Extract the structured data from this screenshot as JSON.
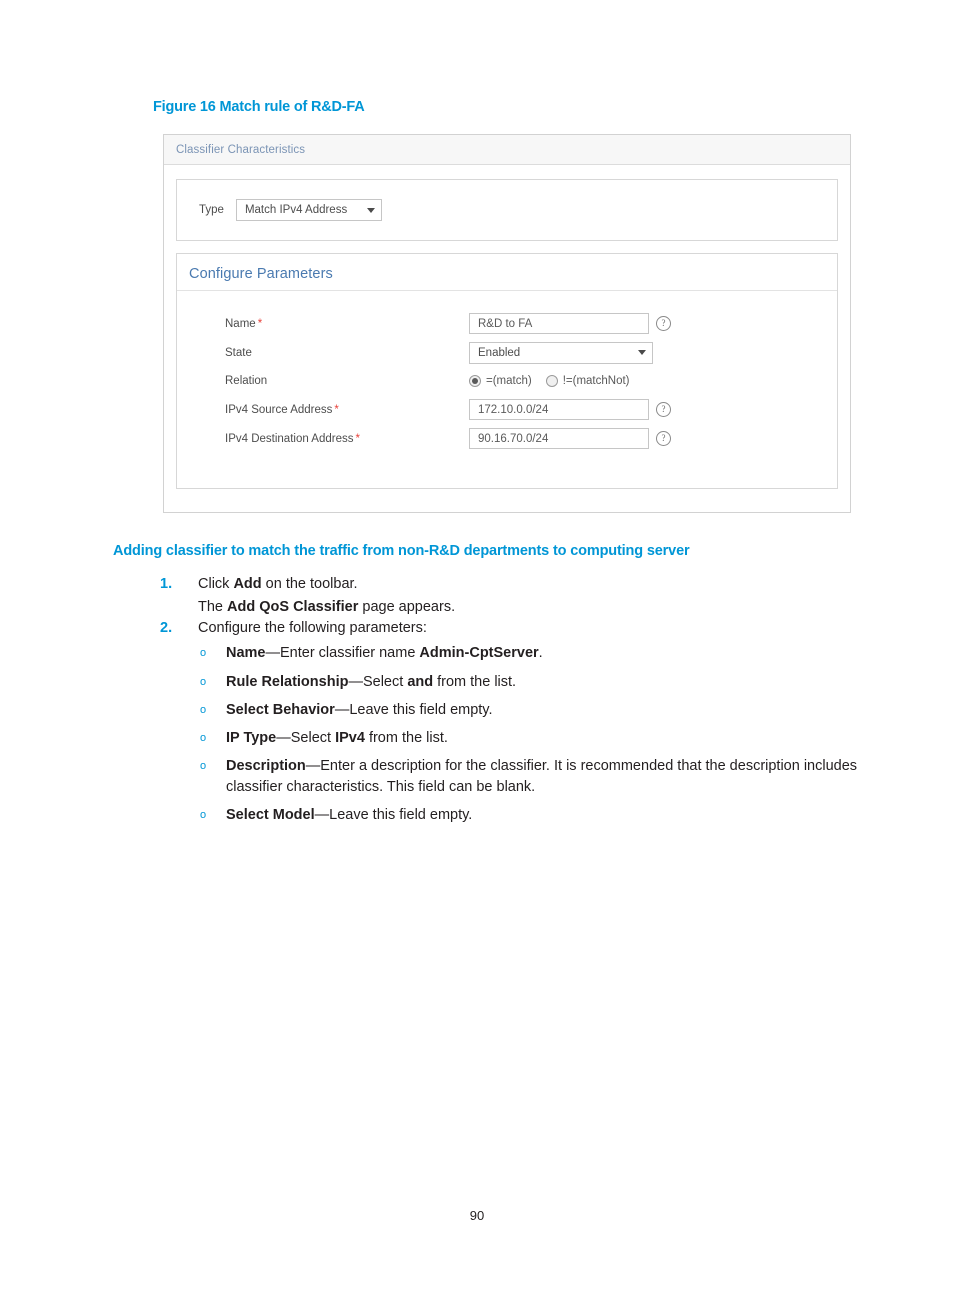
{
  "figure": {
    "caption": "Figure 16 Match rule of R&D-FA",
    "panel_title": "Classifier Characteristics",
    "accent_color": "#0096d6",
    "type_row": {
      "label": "Type",
      "value": "Match IPv4 Address"
    },
    "params": {
      "title": "Configure Parameters",
      "name": {
        "label": "Name",
        "required": "*",
        "value": "R&D to FA"
      },
      "state": {
        "label": "State",
        "value": "Enabled"
      },
      "relation": {
        "label": "Relation",
        "options": [
          {
            "label": "=(match)",
            "selected": true
          },
          {
            "label": "!=(matchNot)",
            "selected": false
          }
        ]
      },
      "ipv4_source": {
        "label": "IPv4 Source Address",
        "required": "*",
        "value": "172.10.0.0/24"
      },
      "ipv4_destination": {
        "label": "IPv4 Destination Address",
        "required": "*",
        "value": "90.16.70.0/24"
      }
    },
    "help_glyph": "?"
  },
  "section": {
    "heading": "Adding classifier to match the traffic from non-R&D departments to computing server",
    "steps": [
      {
        "number": "1.",
        "text_before": "Click ",
        "text_bold": "Add",
        "text_after": " on the toolbar.",
        "sub_before": "The ",
        "sub_bold": "Add QoS Classifier",
        "sub_after": " page appears."
      },
      {
        "number": "2.",
        "text_before": "Configure the following parameters:",
        "text_bold": "",
        "text_after": ""
      }
    ],
    "bullet_marker": "o",
    "bullets": [
      {
        "term": "Name",
        "sep": "—Enter classifier name ",
        "bold2": "Admin-CptServer",
        "tail": "."
      },
      {
        "term": "Rule Relationship",
        "sep": "—Select ",
        "bold2": "and",
        "tail": " from the list."
      },
      {
        "term": "Select Behavior",
        "sep": "—Leave this field empty.",
        "bold2": "",
        "tail": ""
      },
      {
        "term": "IP Type",
        "sep": "—Select ",
        "bold2": "IPv4",
        "tail": " from the list."
      },
      {
        "term": "Description",
        "sep": "—Enter a description for the classifier. It is recommended that the description includes classifier characteristics. This field can be blank.",
        "bold2": "",
        "tail": ""
      },
      {
        "term": "Select Model",
        "sep": "—Leave this field empty.",
        "bold2": "",
        "tail": ""
      }
    ]
  },
  "footer": {
    "page_number": "90"
  }
}
